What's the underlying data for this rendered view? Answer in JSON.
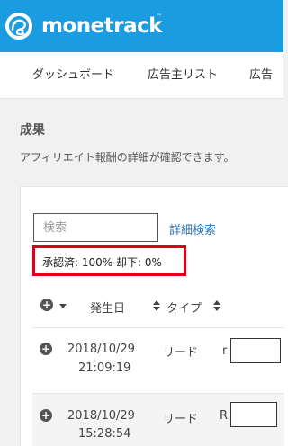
{
  "header": {
    "brand": "monetrack",
    "trademark": "™"
  },
  "nav": {
    "items": [
      {
        "label": "ダッシュボード"
      },
      {
        "label": "広告主リスト"
      },
      {
        "label": "広告"
      }
    ]
  },
  "page": {
    "title": "成果",
    "subtitle": "アフィリエイト報酬の詳細が確認できます。"
  },
  "search": {
    "placeholder": "検索",
    "advanced_label": "詳細検索"
  },
  "status": {
    "text": "承認済: 100% 却下: 0%"
  },
  "table": {
    "columns": {
      "date": "発生日",
      "type": "タイプ"
    },
    "rows": [
      {
        "date": "2018/10/29",
        "time": "21:09:19",
        "type": "リード",
        "name_prefix": "r"
      },
      {
        "date": "2018/10/29",
        "time": "15:28:54",
        "type": "リード",
        "name_prefix": "R"
      }
    ]
  },
  "colors": {
    "header_bg": "#1b9be0",
    "link": "#2a73b8",
    "highlight_border": "#e1001a"
  }
}
